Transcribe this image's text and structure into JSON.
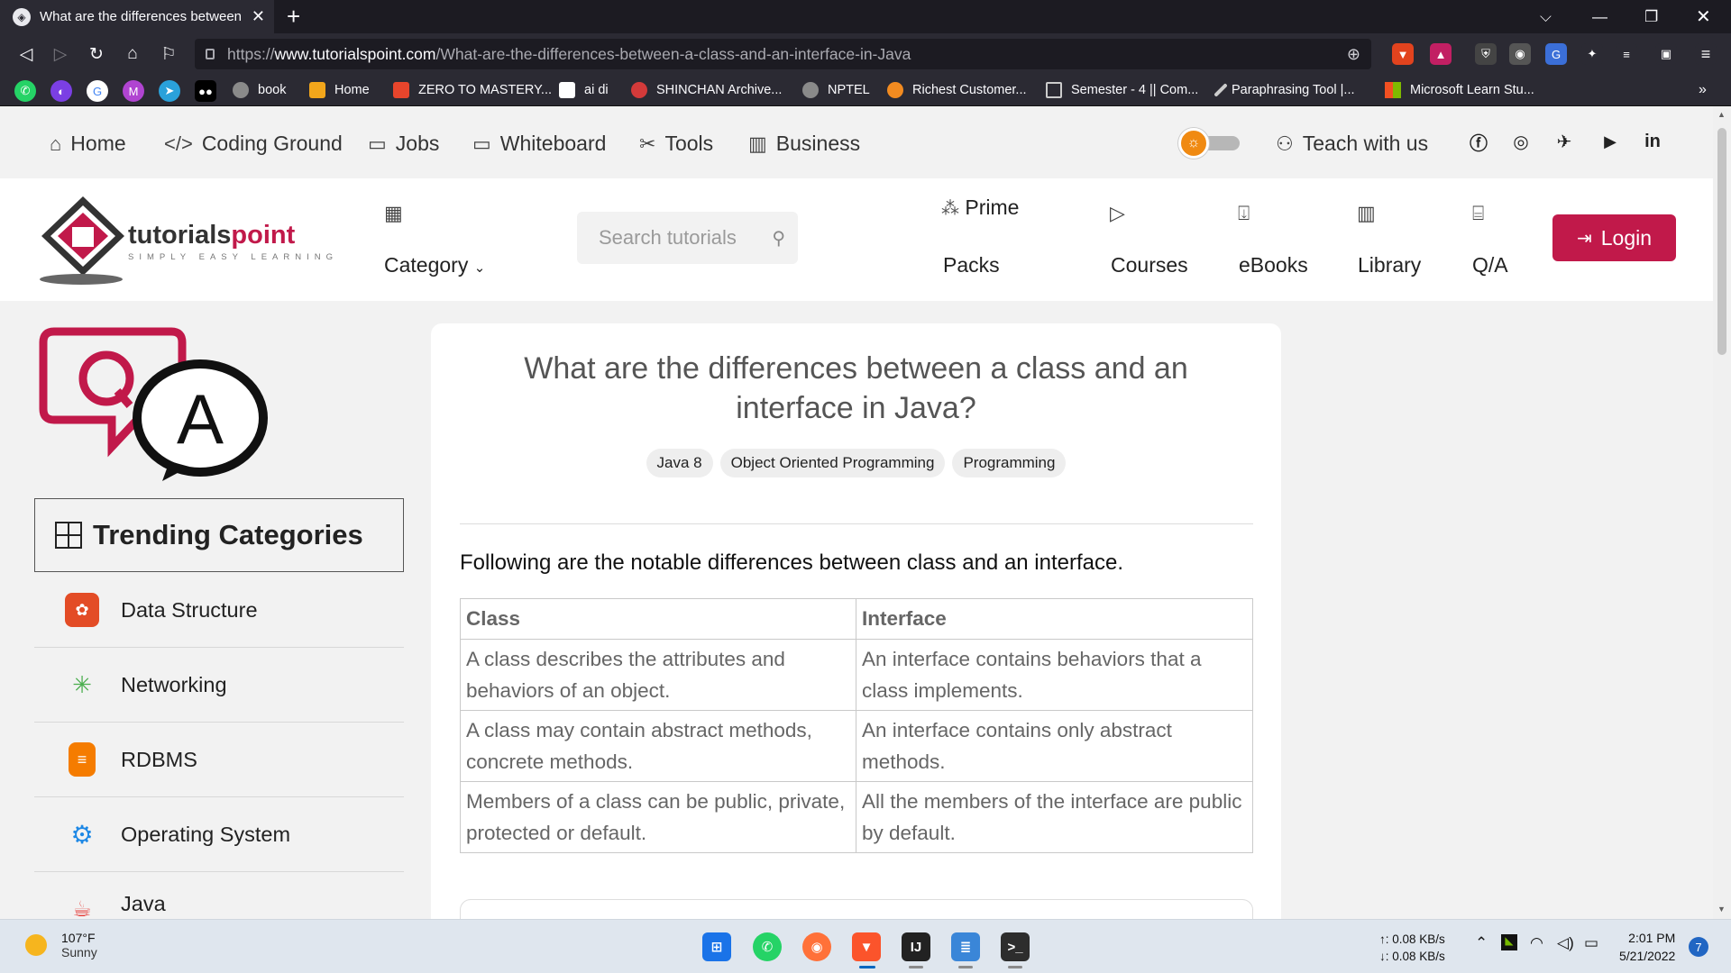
{
  "browser": {
    "tab_title": "What are the differences between",
    "tab_close": "✕",
    "new_tab": "+",
    "url_prefix": "https://",
    "url_host": "www.tutorialspoint.com",
    "url_path": "/What-are-the-differences-between-a-class-and-an-interface-in-Java",
    "bookmarks": [
      {
        "label": "book",
        "color": "#8a8a8a"
      },
      {
        "label": "Home",
        "color": "#f2a61b"
      },
      {
        "label": "ZERO TO MASTERY...",
        "color": "#e8452c"
      },
      {
        "label": "ai di",
        "color": "#ffffff"
      },
      {
        "label": "SHINCHAN Archive...",
        "color": "#d33a3a"
      },
      {
        "label": "NPTEL",
        "color": "#8a8a8a"
      },
      {
        "label": "Richest Customer...",
        "color": "#f28b20"
      },
      {
        "label": "Semester - 4 || Com...",
        "color": "#2b2a33"
      },
      {
        "label": "Paraphrasing Tool |...",
        "color": "#2b2a33"
      },
      {
        "label": "Microsoft Learn Stu...",
        "color": "#f25022"
      }
    ],
    "bookmarks_overflow": "»"
  },
  "topnav": {
    "items": [
      {
        "icon": "⌂",
        "label": "Home"
      },
      {
        "icon": "</>",
        "label": "Coding Ground"
      },
      {
        "icon": "▭",
        "label": "Jobs"
      },
      {
        "icon": "▭",
        "label": "Whiteboard"
      },
      {
        "icon": "✂",
        "label": "Tools"
      },
      {
        "icon": "▥",
        "label": "Business"
      }
    ],
    "teach": "Teach with us"
  },
  "header": {
    "search_placeholder": "Search tutorials",
    "category": "Category",
    "prime": "Prime",
    "packs": "Packs",
    "courses": "Courses",
    "ebooks": "eBooks",
    "library": "Library",
    "qa": "Q/A",
    "login": "Login",
    "logo_name": "tutorialspoint",
    "logo_tagline": "SIMPLY EASY LEARNING"
  },
  "sidebar": {
    "heading": "Trending Categories",
    "categories": [
      {
        "label": "Data Structure",
        "color": "#e34c26"
      },
      {
        "label": "Networking",
        "color": "#4caf50"
      },
      {
        "label": "RDBMS",
        "color": "#f57c00"
      },
      {
        "label": "Operating System",
        "color": "#1e88e5"
      },
      {
        "label": "Java",
        "color": "#e53935"
      }
    ]
  },
  "article": {
    "title": "What are the differences between a class and an interface in Java?",
    "tags": [
      "Java 8",
      "Object Oriented Programming",
      "Programming"
    ],
    "intro": "Following are the notable differences between class and an interface.",
    "table": {
      "headers": [
        "Class",
        "Interface"
      ],
      "rows": [
        [
          "A class describes the attributes and behaviors of an object.",
          "An interface contains behaviors that a class implements."
        ],
        [
          "A class may contain abstract methods, concrete methods.",
          "An interface contains only abstract methods."
        ],
        [
          "Members of a class can be public, private, protected or default.",
          "All the members of the interface are public by default."
        ]
      ]
    }
  },
  "taskbar": {
    "temp": "107°F",
    "condition": "Sunny",
    "net_up": "↑: 0.08 KB/s",
    "net_down": "↓: 0.08 KB/s",
    "time": "2:01 PM",
    "date": "5/21/2022",
    "notifications": "7"
  }
}
